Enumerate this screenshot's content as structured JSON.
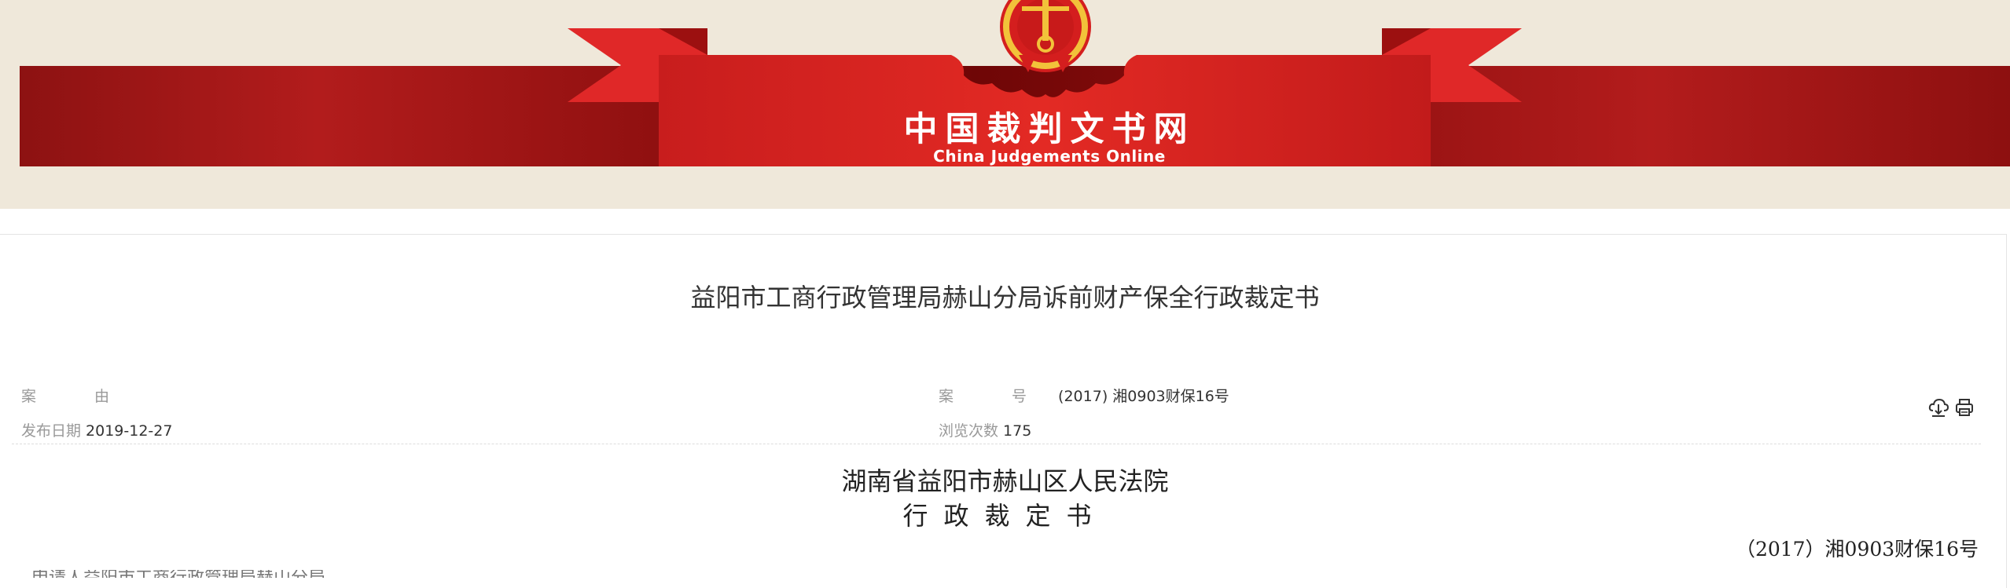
{
  "header": {
    "site_title": "中国裁判文书网",
    "site_subtitle": "China Judgements Online",
    "colors": {
      "banner_bg": "#efe8da",
      "ribbon_red": "#e02323",
      "band_dark": "#7a0a0a",
      "emblem_gold": "#f2c23a"
    }
  },
  "document": {
    "title": "益阳市工商行政管理局赫山分局诉前财产保全行政裁定书",
    "meta": {
      "cause_label": "案 由",
      "cause_value": "",
      "case_no_label": "案 号",
      "case_no_value": "(2017) 湘0903财保16号",
      "publish_date_label": "发布日期",
      "publish_date_value": "2019-12-27",
      "views_label": "浏览次数",
      "views_value": "175"
    },
    "court": "湖南省益阳市赫山区人民法院",
    "doc_type": "行政裁定书",
    "case_no_right": "（2017）湘0903财保16号",
    "partial_line": "申请人益阳市工商行政管理局赫山分局"
  },
  "toolbar": {
    "download_icon": "download-icon",
    "print_icon": "print-icon"
  }
}
